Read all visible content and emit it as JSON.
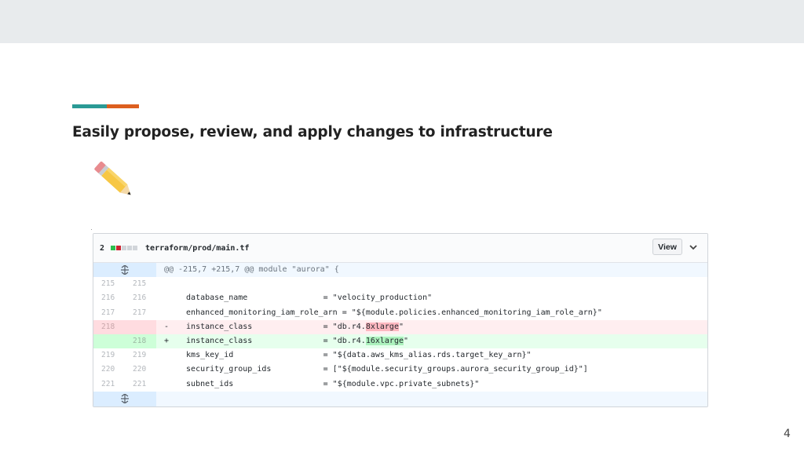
{
  "slide": {
    "title": "Easily propose, review, and apply changes to infrastructure",
    "page_number": "4"
  },
  "colors": {
    "accent_teal": "#2a9a95",
    "accent_orange": "#dd5f1f"
  },
  "icons": {
    "illustration": "pencil-icon",
    "expand": "unfold-icon",
    "toggle": "chevron-down-icon"
  },
  "diff": {
    "count": "2",
    "file_path": "terraform/prod/main.tf",
    "view_label": "View",
    "hunk_header": "@@ -215,7 +215,7 @@ module \"aurora\" {",
    "lines": [
      {
        "old": "215",
        "new": "215",
        "sign": "",
        "code": ""
      },
      {
        "old": "216",
        "new": "216",
        "sign": "",
        "code": "  database_name                = \"velocity_production\""
      },
      {
        "old": "217",
        "new": "217",
        "sign": "",
        "code": "  enhanced_monitoring_iam_role_arn = \"${module.policies.enhanced_monitoring_iam_role_arn}\""
      },
      {
        "old": "218",
        "new": "",
        "sign": "-",
        "code_pre": "  instance_class               = \"db.r4.",
        "code_hl": "8xlarge",
        "code_post": "\""
      },
      {
        "old": "",
        "new": "218",
        "sign": "+",
        "code_pre": "  instance_class               = \"db.r4.",
        "code_hl": "16xlarge",
        "code_post": "\""
      },
      {
        "old": "219",
        "new": "219",
        "sign": "",
        "code": "  kms_key_id                   = \"${data.aws_kms_alias.rds.target_key_arn}\""
      },
      {
        "old": "220",
        "new": "220",
        "sign": "",
        "code": "  security_group_ids           = [\"${module.security_groups.aurora_security_group_id}\"]"
      },
      {
        "old": "221",
        "new": "221",
        "sign": "",
        "code": "  subnet_ids                   = \"${module.vpc.private_subnets}\""
      }
    ]
  }
}
